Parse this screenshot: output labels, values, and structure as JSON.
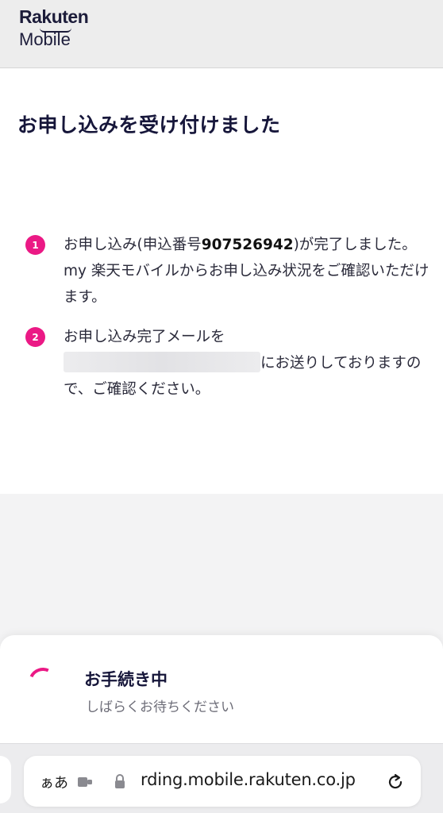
{
  "header": {
    "logo_line1": "Rakuten",
    "logo_line2": "Mobile"
  },
  "main": {
    "title": "お申し込みを受け付けました",
    "steps": [
      {
        "number": "1",
        "text_before": "お申し込み(申込番号",
        "application_number": "907526942",
        "text_after": ")が完了しました。my 楽天モバイルからお申し込み状況をご確認いただけます。"
      },
      {
        "number": "2",
        "text_before": "お申し込み完了メールを",
        "text_after": "にお送りしておりますので、ご確認ください。"
      }
    ]
  },
  "processing_sheet": {
    "title": "お手続き中",
    "subtitle": "しばらくお待ちください"
  },
  "browser": {
    "text_size_label": "ぁあ",
    "url": "rding.mobile.rakuten.co.jp",
    "icons": [
      "extension-icon",
      "lock-icon",
      "reload-icon"
    ]
  },
  "colors": {
    "accent": "#eb1985",
    "text_dark": "#16163a",
    "subtext": "#6d6d78"
  }
}
